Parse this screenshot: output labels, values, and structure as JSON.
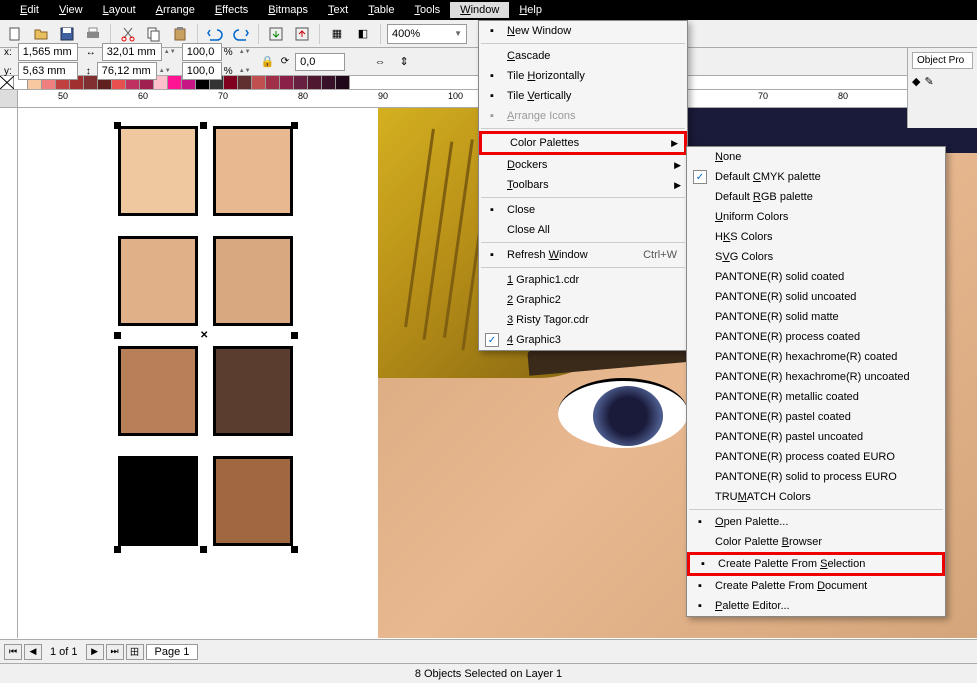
{
  "menubar": [
    "Edit",
    "View",
    "Layout",
    "Arrange",
    "Effects",
    "Bitmaps",
    "Text",
    "Table",
    "Tools",
    "Window",
    "Help"
  ],
  "menubar_active": "Window",
  "toolbar": {
    "zoom": "400%"
  },
  "property_bar": {
    "x": "1,565 mm",
    "y": "5,63 mm",
    "w": "32,01 mm",
    "h": "76,12 mm",
    "sx": "100,0",
    "sy": "100,0",
    "rot": "0,0"
  },
  "color_palette": [
    "#ffffff",
    "#f8c8a0",
    "#f08080",
    "#c04040",
    "#a03030",
    "#803030",
    "#602020",
    "#e85050",
    "#c03060",
    "#a02050",
    "#ffc0cb",
    "#ff1493",
    "#c71585",
    "#000000",
    "#333333",
    "#800020",
    "#603030",
    "#c05050",
    "#a03048",
    "#882048",
    "#682040",
    "#501830",
    "#381028",
    "#200818"
  ],
  "window_menu": {
    "items": [
      {
        "label": "New Window",
        "u": "N",
        "icon": "window"
      },
      {
        "divider": true
      },
      {
        "label": "Cascade",
        "u": "C"
      },
      {
        "label": "Tile Horizontally",
        "u": "H",
        "icon": "tile-h"
      },
      {
        "label": "Tile Vertically",
        "u": "V",
        "icon": "tile-v"
      },
      {
        "label": "Arrange Icons",
        "u": "A",
        "disabled": true,
        "icon": "arrange"
      },
      {
        "divider": true
      },
      {
        "label": "Color Palettes",
        "u": "",
        "sub": true,
        "highlight": true
      },
      {
        "label": "Dockers",
        "u": "D",
        "sub": true
      },
      {
        "label": "Toolbars",
        "u": "T",
        "sub": true
      },
      {
        "divider": true
      },
      {
        "label": "Close",
        "u": "",
        "icon": "close"
      },
      {
        "label": "Close All",
        "u": ""
      },
      {
        "divider": true
      },
      {
        "label": "Refresh Window",
        "u": "W",
        "shortcut": "Ctrl+W",
        "icon": "refresh"
      },
      {
        "divider": true
      },
      {
        "label": "1 Graphic1.cdr",
        "u": "1"
      },
      {
        "label": "2 Graphic2",
        "u": "2"
      },
      {
        "label": "3 Risty Tagor.cdr",
        "u": "3"
      },
      {
        "label": "4 Graphic3",
        "u": "4",
        "checked": true
      }
    ]
  },
  "palette_submenu": [
    {
      "label": "None",
      "u": "N"
    },
    {
      "label": "Default CMYK palette",
      "u": "C",
      "checked": true
    },
    {
      "label": "Default RGB palette",
      "u": "R"
    },
    {
      "label": "Uniform Colors",
      "u": "U"
    },
    {
      "label": "HKS Colors",
      "u": "K"
    },
    {
      "label": "SVG Colors",
      "u": "V"
    },
    {
      "label": "PANTONE(R) solid coated"
    },
    {
      "label": "PANTONE(R) solid uncoated"
    },
    {
      "label": "PANTONE(R) solid matte"
    },
    {
      "label": "PANTONE(R) process coated"
    },
    {
      "label": "PANTONE(R) hexachrome(R) coated"
    },
    {
      "label": "PANTONE(R) hexachrome(R) uncoated"
    },
    {
      "label": "PANTONE(R) metallic coated"
    },
    {
      "label": "PANTONE(R) pastel coated"
    },
    {
      "label": "PANTONE(R) pastel uncoated"
    },
    {
      "label": "PANTONE(R) process coated EURO"
    },
    {
      "label": "PANTONE(R) solid to process EURO"
    },
    {
      "label": "TRUMATCH Colors",
      "u": "M"
    },
    {
      "divider": true
    },
    {
      "label": "Open Palette...",
      "u": "O",
      "icon": "open"
    },
    {
      "label": "Color Palette Browser",
      "u": "B"
    },
    {
      "label": "Create Palette From Selection",
      "u": "S",
      "highlight": true,
      "icon": "from-sel"
    },
    {
      "label": "Create Palette From Document",
      "u": "D",
      "icon": "from-doc"
    },
    {
      "label": "Palette Editor...",
      "u": "P",
      "icon": "editor"
    }
  ],
  "ruler": {
    "labels": [
      "50",
      "60",
      "70",
      "80",
      "90",
      "100",
      "60",
      "70",
      "80"
    ],
    "units": "millimeters"
  },
  "right_panel": {
    "tab": "Object Pro"
  },
  "pages": {
    "count": "1 of 1",
    "tab": "Page 1"
  },
  "status": "8 Objects Selected on Layer 1"
}
